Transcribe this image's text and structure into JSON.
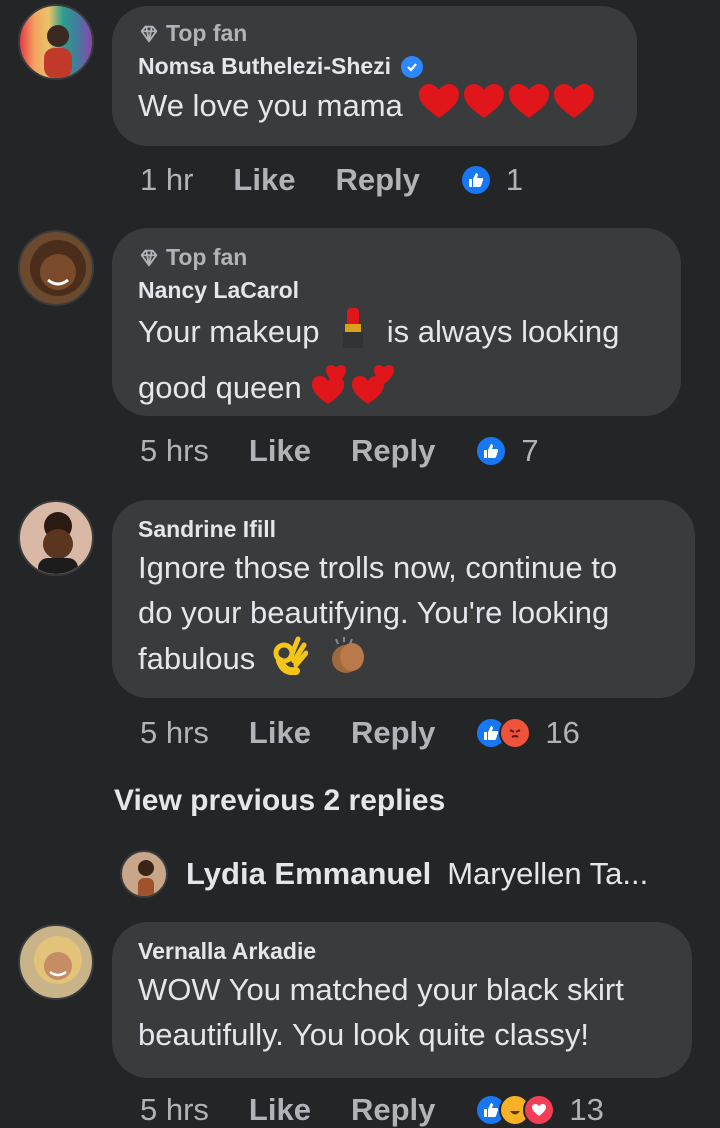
{
  "comments": [
    {
      "badge": "Top fan",
      "name": "Nomsa Buthelezi-Shezi",
      "verified": true,
      "lines": [
        "We love you mama"
      ],
      "time": "1 hr",
      "like_label": "Like",
      "reply_label": "Reply",
      "reaction_count": "1"
    },
    {
      "badge": "Top fan",
      "name": "Nancy LaCarol",
      "lines": [
        "Your makeup",
        "is always looking",
        "good queen"
      ],
      "time": "5 hrs",
      "like_label": "Like",
      "reply_label": "Reply",
      "reaction_count": "7"
    },
    {
      "name": "Sandrine Ifill",
      "lines": [
        "Ignore those trolls now, continue to",
        "do your beautifying. You're looking",
        "fabulous"
      ],
      "time": "5 hrs",
      "like_label": "Like",
      "reply_label": "Reply",
      "reaction_count": "16"
    },
    {
      "name": "Vernalla Arkadie",
      "lines": [
        "WOW You matched your black skirt",
        "beautifully. You look quite classy!"
      ],
      "time": "5 hrs",
      "like_label": "Like",
      "reply_label": "Reply",
      "reaction_count": "13"
    }
  ],
  "view_previous": "View previous 2 replies",
  "reply_preview": {
    "name": "Lydia Emmanuel",
    "text": "Maryellen Ta..."
  },
  "colors": {
    "background": "#242526",
    "bubble": "#3a3b3c",
    "like_blue": "#1877f2",
    "verified_blue": "#2d88ff"
  }
}
